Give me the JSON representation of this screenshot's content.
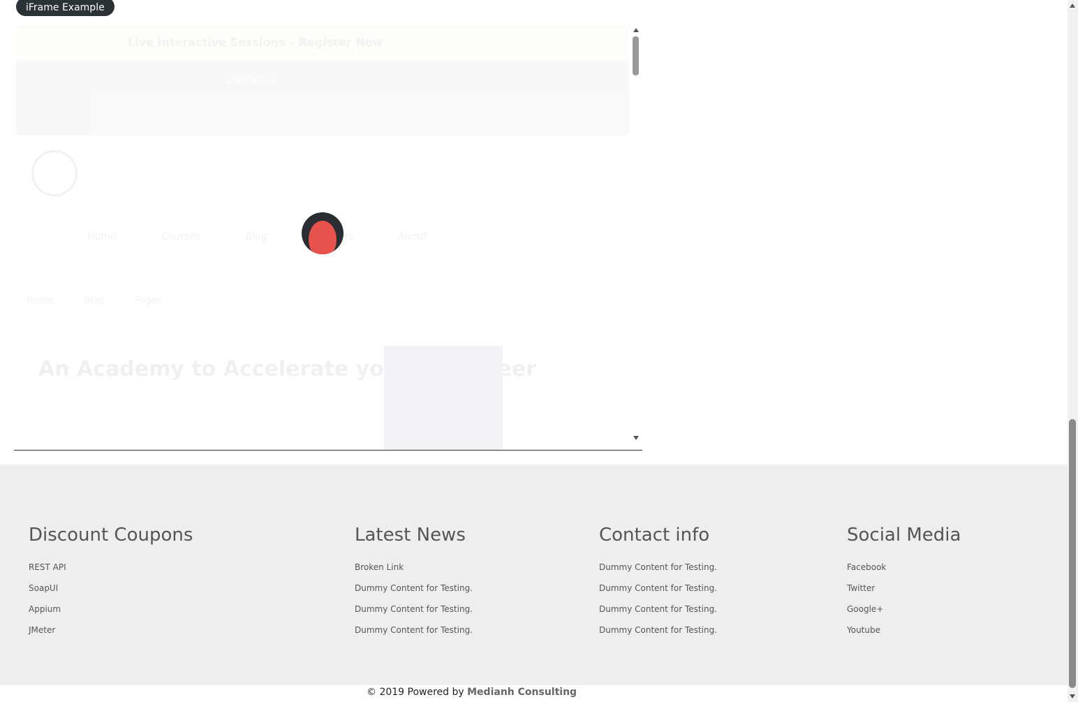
{
  "iframe": {
    "legend": "iFrame Example",
    "inner": {
      "top_banner": "Live Interactive Sessions – Register Now",
      "sub_banner": "Contact us",
      "nav": "Home Courses Blog Services About",
      "crumbs": "Home Blog Pages",
      "hero": "An Academy to Accelerate your QA Career"
    }
  },
  "footer": {
    "columns": [
      {
        "heading": "Discount Coupons",
        "links": [
          "REST API",
          "SoapUI",
          "Appium",
          "JMeter"
        ]
      },
      {
        "heading": "Latest News",
        "links": [
          "Broken Link",
          "Dummy Content for Testing.",
          "Dummy Content for Testing.",
          "Dummy Content for Testing."
        ]
      },
      {
        "heading": "Contact info",
        "links": [
          "Dummy Content for Testing.",
          "Dummy Content for Testing.",
          "Dummy Content for Testing.",
          "Dummy Content for Testing."
        ]
      },
      {
        "heading": "Social Media",
        "links": [
          "Facebook",
          "Twitter",
          "Google+",
          "Youtube"
        ]
      }
    ],
    "copyright_prefix": "© 2019 Powered by",
    "copyright_link": "Medianh Consulting"
  }
}
